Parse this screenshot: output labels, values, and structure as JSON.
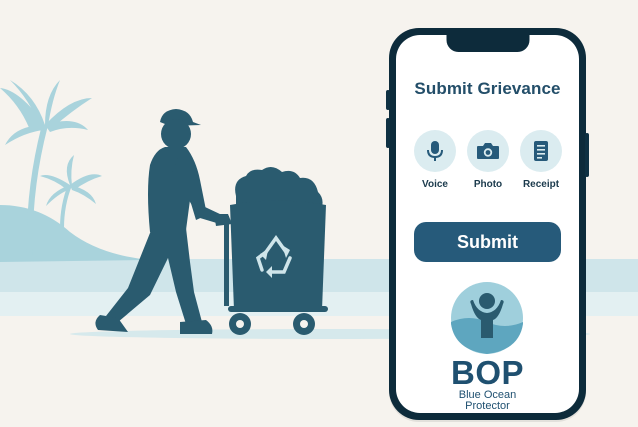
{
  "app": {
    "title": "Submit Grievance",
    "options": [
      {
        "label": "Voice",
        "icon": "microphone-icon"
      },
      {
        "label": "Photo",
        "icon": "camera-icon"
      },
      {
        "label": "Receipt",
        "icon": "receipt-icon"
      }
    ],
    "submit_label": "Submit",
    "brand": {
      "name": "BOP",
      "line1": "Blue Ocean",
      "line2": "Protector"
    }
  },
  "colors": {
    "background": "#f6f3ee",
    "silhouette": "#2a5b6f",
    "accent": "#265a7a",
    "icon_bg": "#dbecf0",
    "phone_frame": "#0d2b3b",
    "water": "#cfe5ea",
    "palm": "#a9d3dc"
  }
}
